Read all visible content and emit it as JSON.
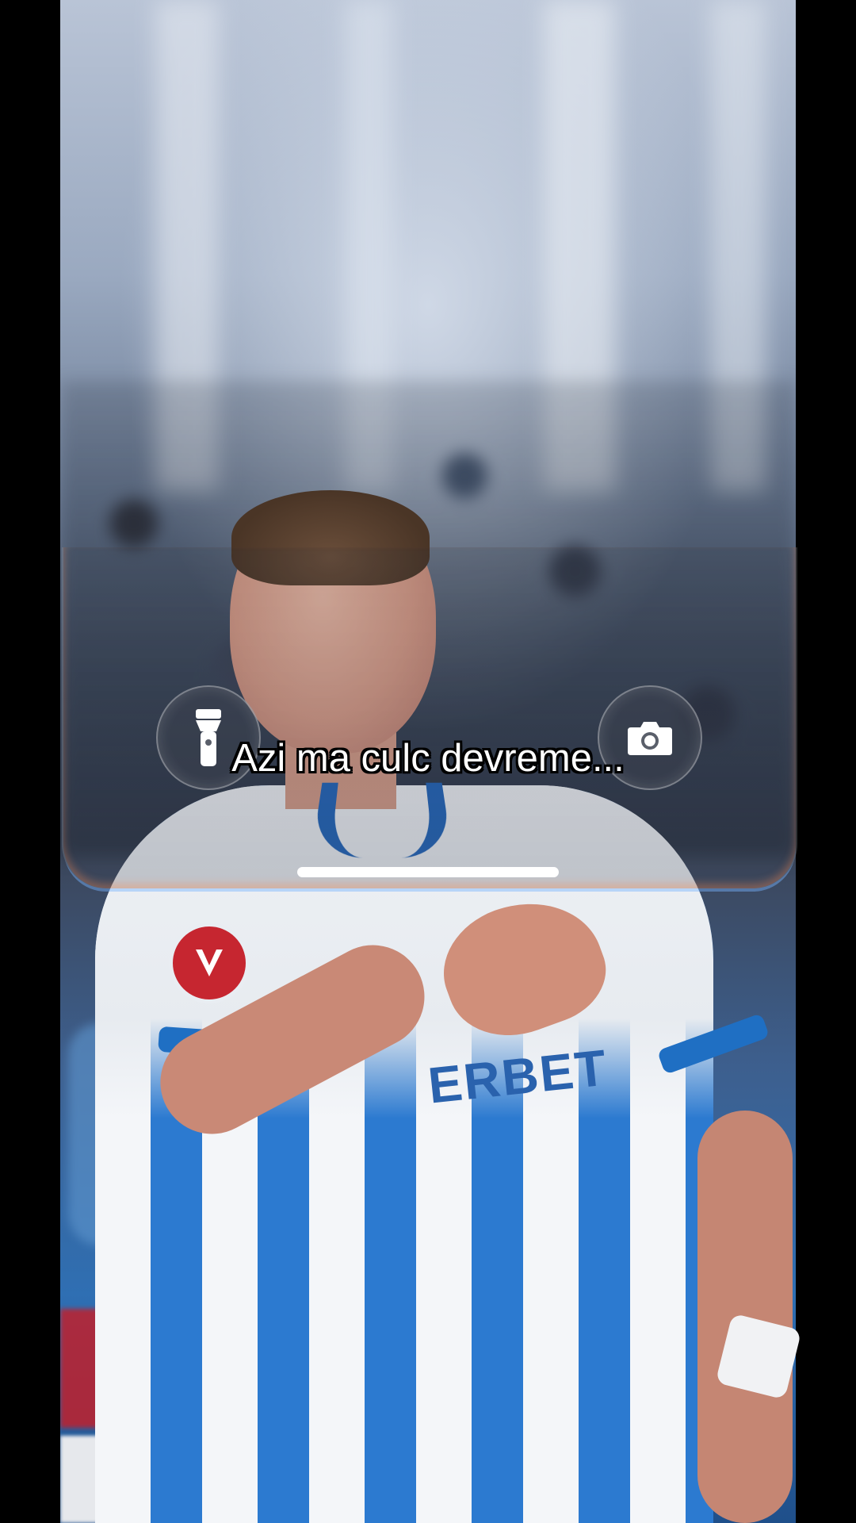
{
  "caption": {
    "text": "Azi ma culc devreme..."
  },
  "quick_actions": {
    "flashlight_icon": "flashlight-icon",
    "camera_icon": "camera-icon"
  },
  "scene": {
    "sponsor_text": "ERBET",
    "accent_blue": "#2c7ad0",
    "league_badge_color": "#c62630"
  }
}
